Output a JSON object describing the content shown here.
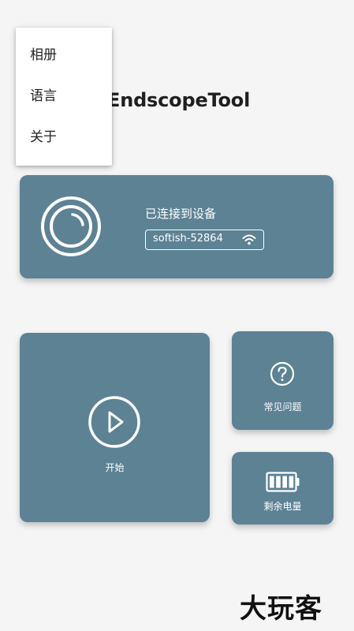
{
  "app": {
    "title": "EndscopeTool"
  },
  "menu": {
    "items": [
      {
        "label": "相册"
      },
      {
        "label": "语言"
      },
      {
        "label": "关于"
      }
    ]
  },
  "device_card": {
    "status_text": "已连接到设备",
    "wifi_name": "softish-52864",
    "icon": "camera-lens-icon",
    "wifi_icon": "wifi-icon"
  },
  "start_card": {
    "label": "开始",
    "icon": "play-icon"
  },
  "faq_card": {
    "label": "常见问题",
    "icon": "help-icon"
  },
  "battery_card": {
    "label": "剩余电量",
    "icon": "battery-icon",
    "level": 1.0
  },
  "watermark": {
    "text": "大玩客"
  },
  "colors": {
    "card_background": "#5c8294",
    "page_background": "#f5f5f5",
    "card_foreground": "#ffffff"
  }
}
